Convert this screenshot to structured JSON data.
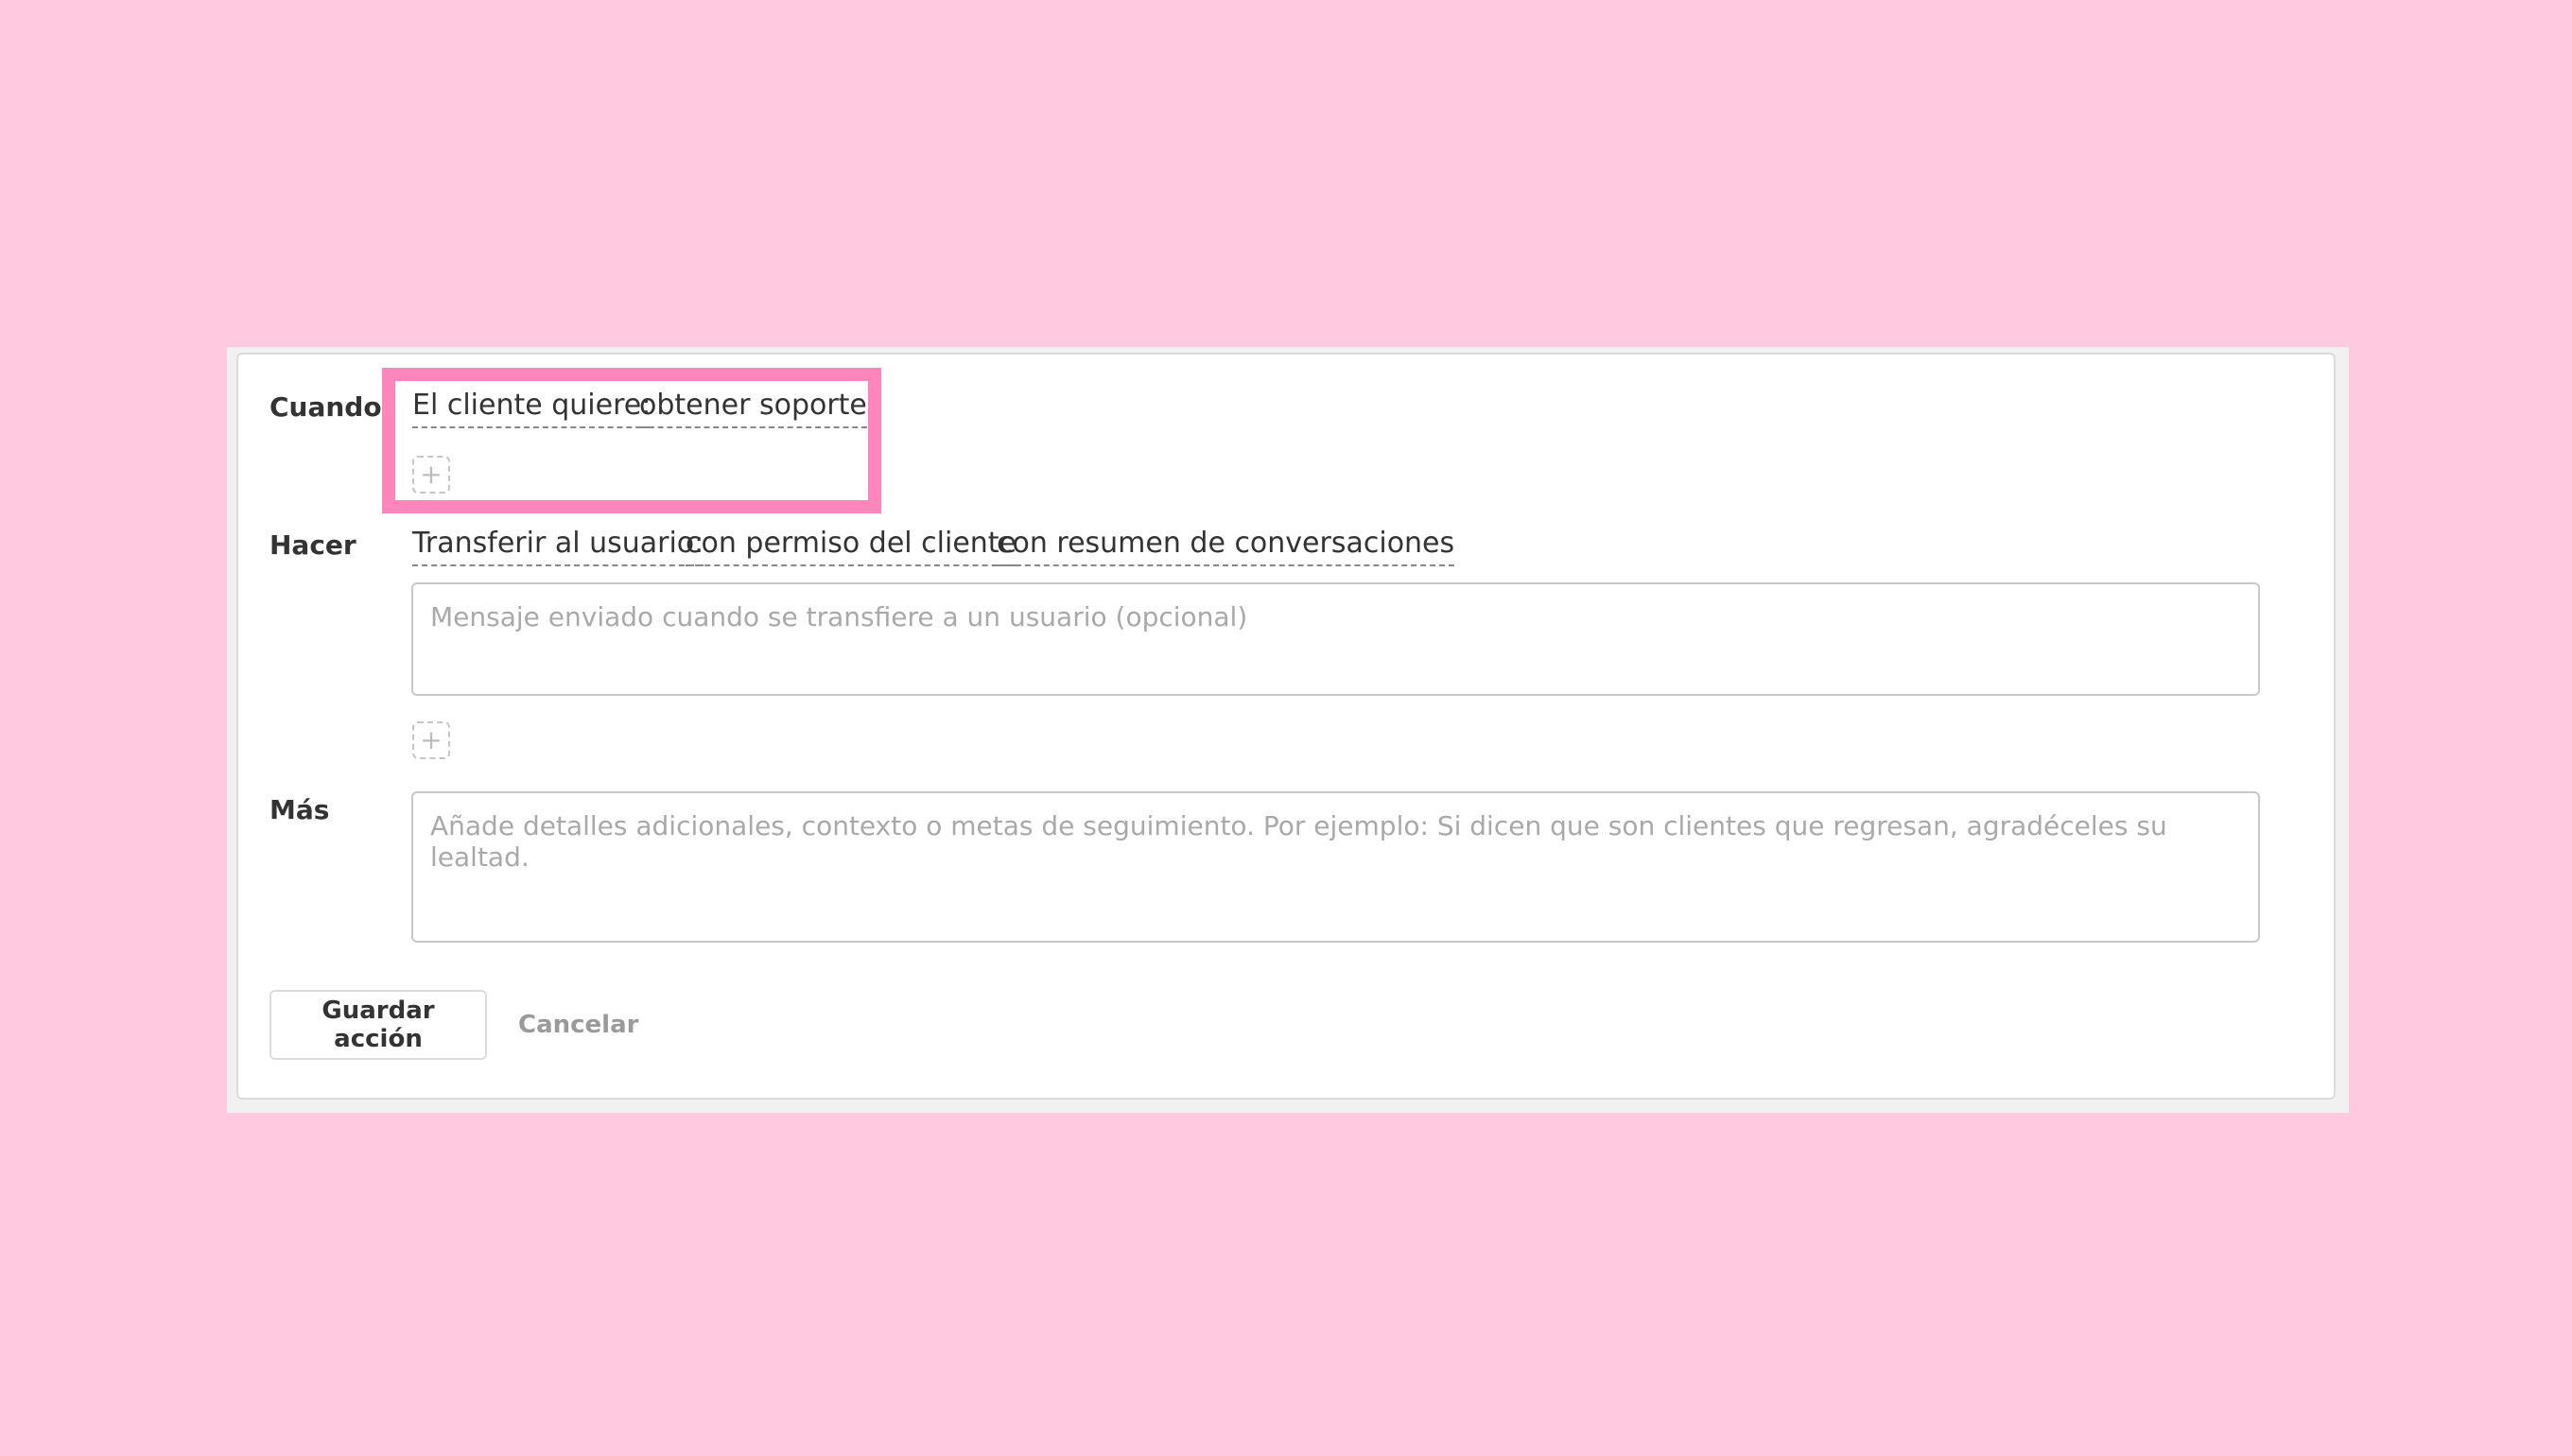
{
  "colors": {
    "background": "#ffc9e0",
    "highlight": "#ff85bd",
    "card_border": "#dcdcdc",
    "text": "#333333",
    "placeholder": "#a9a9a9"
  },
  "when": {
    "label": "Cuando",
    "chips": [
      "El cliente quiere:",
      "obtener soporte"
    ],
    "add_icon": "plus-icon",
    "add_symbol": "+"
  },
  "do": {
    "label": "Hacer",
    "chips": [
      "Transferir al usuario:",
      "con permiso del cliente",
      "con resumen de conversaciones"
    ],
    "message_placeholder": "Mensaje enviado cuando se transfiere a un usuario (opcional)",
    "add_icon": "plus-icon",
    "add_symbol": "+"
  },
  "more": {
    "label": "Más",
    "placeholder": "Añade detalles adicionales, contexto o metas de seguimiento. Por ejemplo: Si dicen que son clientes que regresan, agradéceles su lealtad."
  },
  "actions": {
    "save_label": "Guardar acción",
    "cancel_label": "Cancelar"
  }
}
